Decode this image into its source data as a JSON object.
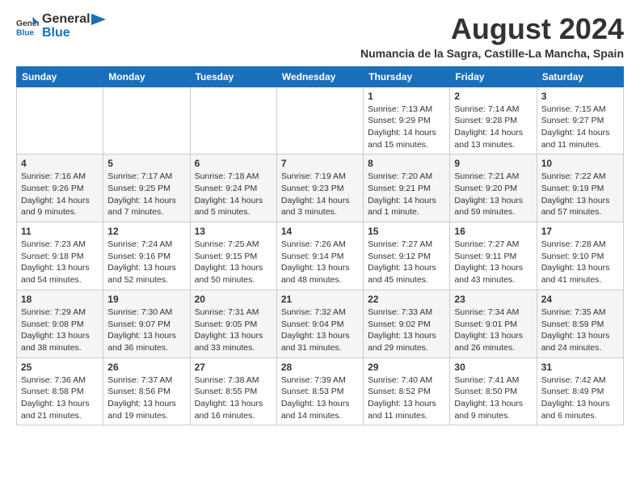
{
  "header": {
    "logo_general": "General",
    "logo_blue": "Blue",
    "title": "August 2024",
    "subtitle": "Numancia de la Sagra, Castille-La Mancha, Spain"
  },
  "weekdays": [
    "Sunday",
    "Monday",
    "Tuesday",
    "Wednesday",
    "Thursday",
    "Friday",
    "Saturday"
  ],
  "weeks": [
    {
      "days": [
        {
          "num": "",
          "content": ""
        },
        {
          "num": "",
          "content": ""
        },
        {
          "num": "",
          "content": ""
        },
        {
          "num": "",
          "content": ""
        },
        {
          "num": "1",
          "content": "Sunrise: 7:13 AM\nSunset: 9:29 PM\nDaylight: 14 hours and 15 minutes."
        },
        {
          "num": "2",
          "content": "Sunrise: 7:14 AM\nSunset: 9:28 PM\nDaylight: 14 hours and 13 minutes."
        },
        {
          "num": "3",
          "content": "Sunrise: 7:15 AM\nSunset: 9:27 PM\nDaylight: 14 hours and 11 minutes."
        }
      ]
    },
    {
      "days": [
        {
          "num": "4",
          "content": "Sunrise: 7:16 AM\nSunset: 9:26 PM\nDaylight: 14 hours and 9 minutes."
        },
        {
          "num": "5",
          "content": "Sunrise: 7:17 AM\nSunset: 9:25 PM\nDaylight: 14 hours and 7 minutes."
        },
        {
          "num": "6",
          "content": "Sunrise: 7:18 AM\nSunset: 9:24 PM\nDaylight: 14 hours and 5 minutes."
        },
        {
          "num": "7",
          "content": "Sunrise: 7:19 AM\nSunset: 9:23 PM\nDaylight: 14 hours and 3 minutes."
        },
        {
          "num": "8",
          "content": "Sunrise: 7:20 AM\nSunset: 9:21 PM\nDaylight: 14 hours and 1 minute."
        },
        {
          "num": "9",
          "content": "Sunrise: 7:21 AM\nSunset: 9:20 PM\nDaylight: 13 hours and 59 minutes."
        },
        {
          "num": "10",
          "content": "Sunrise: 7:22 AM\nSunset: 9:19 PM\nDaylight: 13 hours and 57 minutes."
        }
      ]
    },
    {
      "days": [
        {
          "num": "11",
          "content": "Sunrise: 7:23 AM\nSunset: 9:18 PM\nDaylight: 13 hours and 54 minutes."
        },
        {
          "num": "12",
          "content": "Sunrise: 7:24 AM\nSunset: 9:16 PM\nDaylight: 13 hours and 52 minutes."
        },
        {
          "num": "13",
          "content": "Sunrise: 7:25 AM\nSunset: 9:15 PM\nDaylight: 13 hours and 50 minutes."
        },
        {
          "num": "14",
          "content": "Sunrise: 7:26 AM\nSunset: 9:14 PM\nDaylight: 13 hours and 48 minutes."
        },
        {
          "num": "15",
          "content": "Sunrise: 7:27 AM\nSunset: 9:12 PM\nDaylight: 13 hours and 45 minutes."
        },
        {
          "num": "16",
          "content": "Sunrise: 7:27 AM\nSunset: 9:11 PM\nDaylight: 13 hours and 43 minutes."
        },
        {
          "num": "17",
          "content": "Sunrise: 7:28 AM\nSunset: 9:10 PM\nDaylight: 13 hours and 41 minutes."
        }
      ]
    },
    {
      "days": [
        {
          "num": "18",
          "content": "Sunrise: 7:29 AM\nSunset: 9:08 PM\nDaylight: 13 hours and 38 minutes."
        },
        {
          "num": "19",
          "content": "Sunrise: 7:30 AM\nSunset: 9:07 PM\nDaylight: 13 hours and 36 minutes."
        },
        {
          "num": "20",
          "content": "Sunrise: 7:31 AM\nSunset: 9:05 PM\nDaylight: 13 hours and 33 minutes."
        },
        {
          "num": "21",
          "content": "Sunrise: 7:32 AM\nSunset: 9:04 PM\nDaylight: 13 hours and 31 minutes."
        },
        {
          "num": "22",
          "content": "Sunrise: 7:33 AM\nSunset: 9:02 PM\nDaylight: 13 hours and 29 minutes."
        },
        {
          "num": "23",
          "content": "Sunrise: 7:34 AM\nSunset: 9:01 PM\nDaylight: 13 hours and 26 minutes."
        },
        {
          "num": "24",
          "content": "Sunrise: 7:35 AM\nSunset: 8:59 PM\nDaylight: 13 hours and 24 minutes."
        }
      ]
    },
    {
      "days": [
        {
          "num": "25",
          "content": "Sunrise: 7:36 AM\nSunset: 8:58 PM\nDaylight: 13 hours and 21 minutes."
        },
        {
          "num": "26",
          "content": "Sunrise: 7:37 AM\nSunset: 8:56 PM\nDaylight: 13 hours and 19 minutes."
        },
        {
          "num": "27",
          "content": "Sunrise: 7:38 AM\nSunset: 8:55 PM\nDaylight: 13 hours and 16 minutes."
        },
        {
          "num": "28",
          "content": "Sunrise: 7:39 AM\nSunset: 8:53 PM\nDaylight: 13 hours and 14 minutes."
        },
        {
          "num": "29",
          "content": "Sunrise: 7:40 AM\nSunset: 8:52 PM\nDaylight: 13 hours and 11 minutes."
        },
        {
          "num": "30",
          "content": "Sunrise: 7:41 AM\nSunset: 8:50 PM\nDaylight: 13 hours and 9 minutes."
        },
        {
          "num": "31",
          "content": "Sunrise: 7:42 AM\nSunset: 8:49 PM\nDaylight: 13 hours and 6 minutes."
        }
      ]
    }
  ]
}
